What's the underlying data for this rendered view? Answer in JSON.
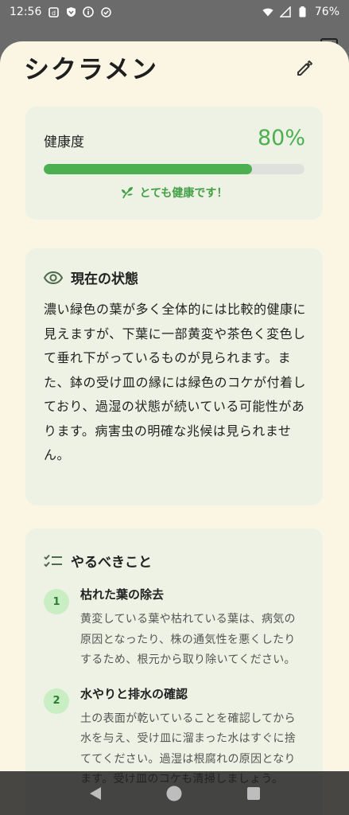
{
  "status_bar": {
    "time": "12:56",
    "battery": "76%"
  },
  "sheet": {
    "title": "シクラメン"
  },
  "health": {
    "label": "健康度",
    "value": "80%",
    "progress": 0.8,
    "message": "とても健康です！",
    "accent": "#4caf50"
  },
  "current_status": {
    "title": "現在の状態",
    "text": "濃い緑色の葉が多く全体的には比較的健康に見えますが、下葉に一部黄変や茶色く変色して垂れ下がっているものが見られます。また、鉢の受け皿の縁には緑色のコケが付着しており、過湿の状態が続いている可能性があります。病害虫の明確な兆候は見られません。"
  },
  "todo": {
    "title": "やるべきこと",
    "items": [
      {
        "num": "1",
        "title": "枯れた葉の除去",
        "desc": "黄変している葉や枯れている葉は、病気の原因となったり、株の通気性を悪くしたりするため、根元から取り除いてください。"
      },
      {
        "num": "2",
        "title": "水やりと排水の確認",
        "desc": "土の表面が乾いていることを確認してから水を与え、受け皿に溜まった水はすぐに捨ててください。過湿は根腐れの原因となります。受け皿のコケも清掃しましょう。"
      }
    ]
  },
  "icons": {
    "edit": "pencil-icon",
    "status": "eye-icon",
    "todo": "checklist-icon",
    "health": "sprout-icon"
  }
}
